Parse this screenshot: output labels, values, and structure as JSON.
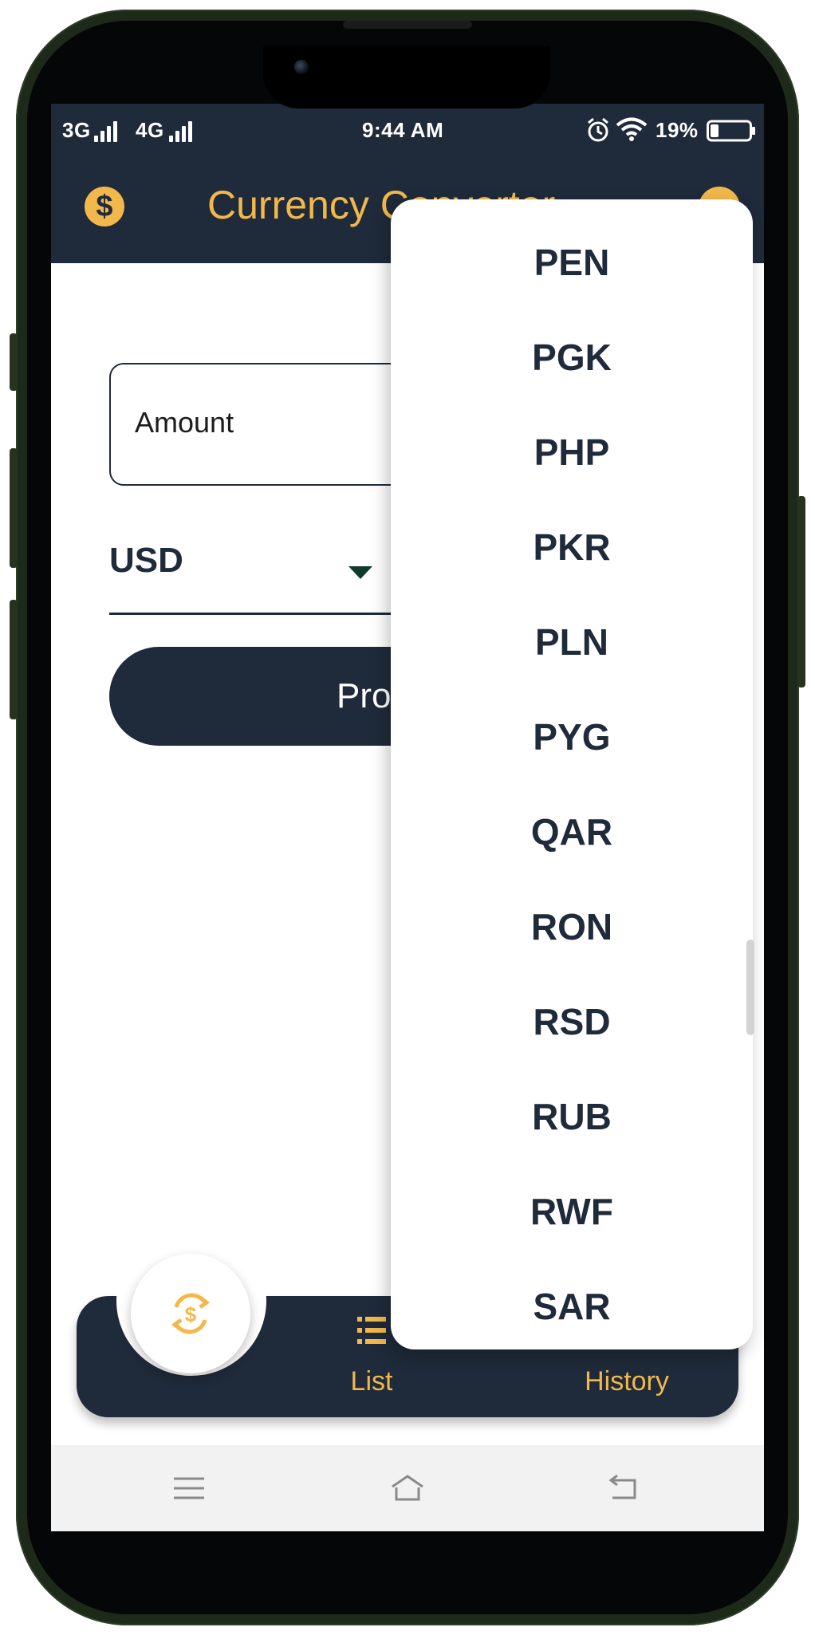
{
  "status_bar": {
    "network1": "3G",
    "network2": "4G",
    "time": "9:44 AM",
    "battery": "19%"
  },
  "app_bar": {
    "title": "Currency Converter"
  },
  "form": {
    "amount_placeholder": "Amount",
    "from_currency": "USD",
    "process_label": "Process"
  },
  "bottom_nav": {
    "items": [
      {
        "label": ""
      },
      {
        "label": "List"
      },
      {
        "label": "History"
      }
    ]
  },
  "dropdown": {
    "options": [
      "PEN",
      "PGK",
      "PHP",
      "PKR",
      "PLN",
      "PYG",
      "QAR",
      "RON",
      "RSD",
      "RUB",
      "RWF",
      "SAR"
    ]
  },
  "colors": {
    "primary_dark": "#1f2a3a",
    "accent_gold": "#f2b84b",
    "phone_frame": "#1e2a19"
  },
  "icons": {
    "app_logo": "dollar-coin-icon",
    "fab": "currency-exchange-icon",
    "list": "list-icon",
    "history": "history-icon",
    "alarm": "alarm-icon",
    "wifi": "wifi-icon",
    "battery": "battery-icon"
  }
}
